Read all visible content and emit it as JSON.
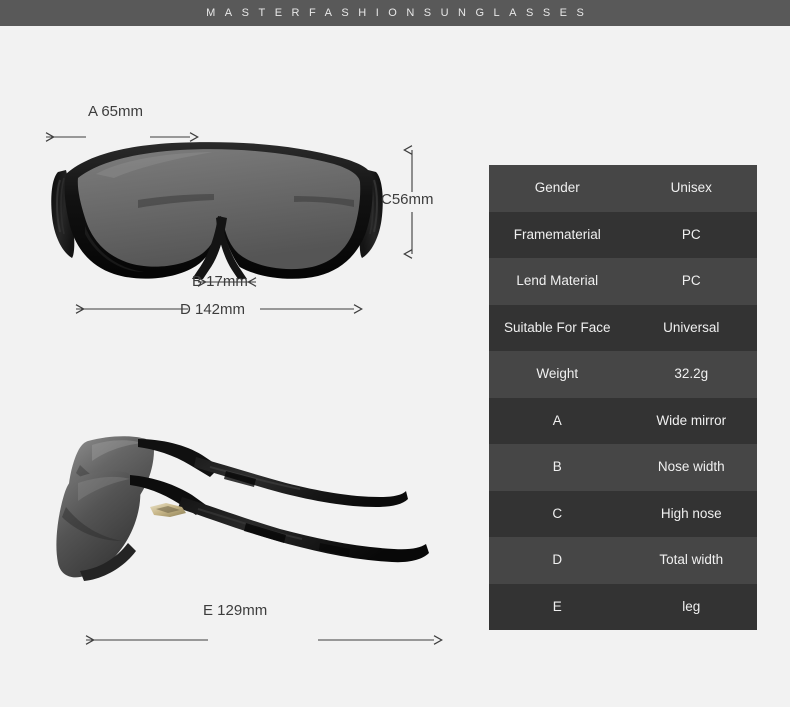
{
  "brand_bar": {
    "text": "MASTERFASHIONSUNGLASSES"
  },
  "colors": {
    "background": "#f2f2f2",
    "brand_bar": "#595959",
    "table_row_light": "#464646",
    "table_row_dark": "#333333",
    "table_text": "#f0f0f0",
    "dimension_text": "#3d3d3d",
    "frame_black": "#121212",
    "lens_gray": "#6e6e6e"
  },
  "dimensions": {
    "a": "A 65mm",
    "b": "B 17mm",
    "c": "C56mm",
    "d": "D 142mm",
    "e": "E 129mm"
  },
  "photos": {
    "front_view": "sunglasses-front-view",
    "side_view": "sunglasses-side-view",
    "logo_badge": "brand-logo-badge"
  },
  "spec_table": {
    "rows": [
      {
        "key": "Gender",
        "value": "Unisex"
      },
      {
        "key": "Framematerial",
        "value": "PC"
      },
      {
        "key": "Lend Material",
        "value": "PC"
      },
      {
        "key": "Suitable For Face",
        "value": "Universal"
      },
      {
        "key": "Weight",
        "value": "32.2g"
      },
      {
        "key": "A",
        "value": "Wide mirror"
      },
      {
        "key": "B",
        "value": "Nose width"
      },
      {
        "key": "C",
        "value": "High nose"
      },
      {
        "key": "D",
        "value": "Total width"
      },
      {
        "key": "E",
        "value": "leg"
      }
    ]
  }
}
